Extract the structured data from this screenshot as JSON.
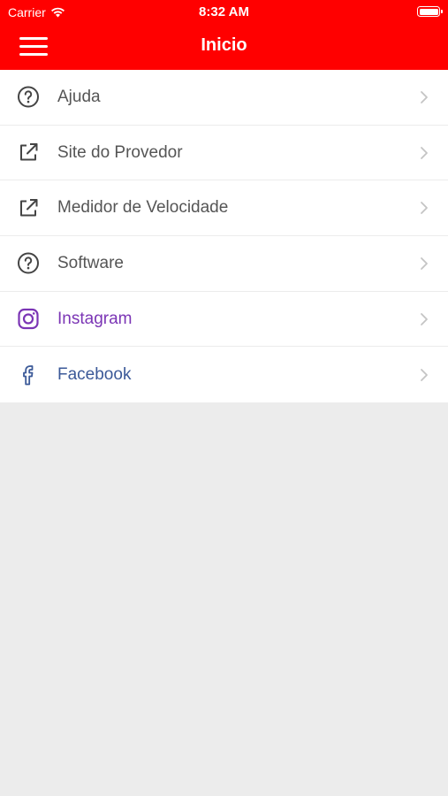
{
  "status_bar": {
    "carrier": "Carrier",
    "time": "8:32 AM"
  },
  "nav": {
    "title": "Inicio"
  },
  "colors": {
    "header": "#ff0000",
    "instagram": "#7b35b5",
    "facebook": "#3b5998",
    "default_text": "#555555",
    "background": "#ececec"
  },
  "menu": {
    "items": [
      {
        "label": "Ajuda",
        "icon": "help-circle-icon"
      },
      {
        "label": "Site do Provedor",
        "icon": "external-link-icon"
      },
      {
        "label": "Medidor de Velocidade",
        "icon": "external-link-icon"
      },
      {
        "label": "Software",
        "icon": "help-circle-icon"
      },
      {
        "label": "Instagram",
        "icon": "instagram-icon"
      },
      {
        "label": "Facebook",
        "icon": "facebook-icon"
      }
    ]
  }
}
